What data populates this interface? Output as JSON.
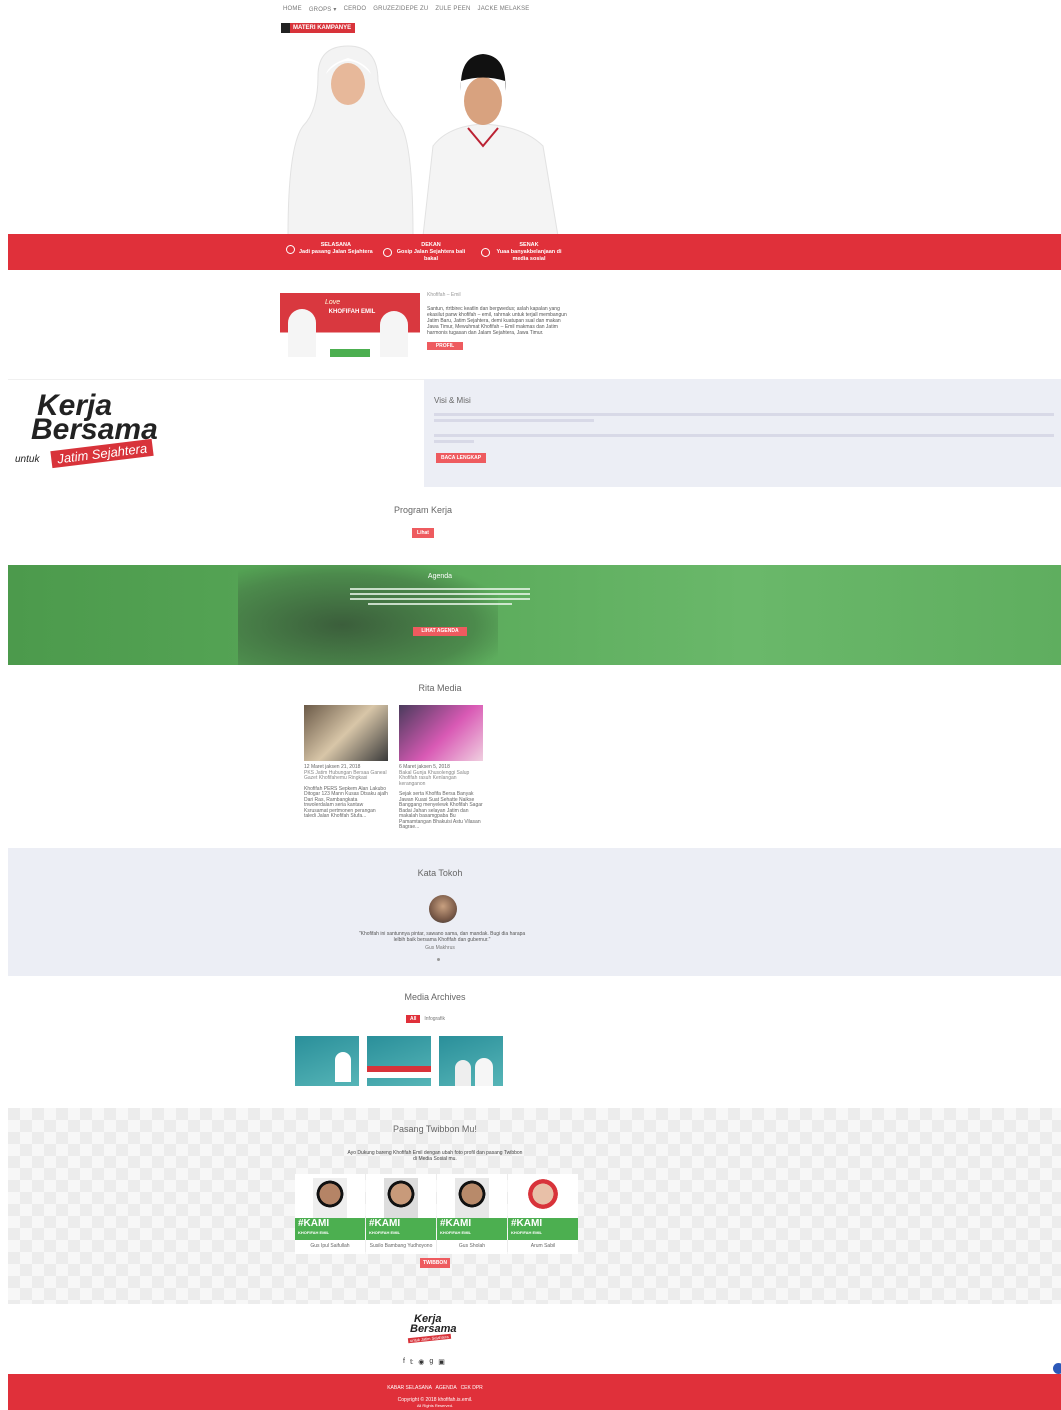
{
  "nav": {
    "items": [
      "HOME",
      "GROPS ▾",
      "CERDO",
      "GRUZEZIDEPE ZU",
      "ZULE PEEN",
      "JACKE MELAKSE"
    ]
  },
  "badge": "MATERI KAMPANYE",
  "features": [
    {
      "title": "SELASANA",
      "sub": "Jadi pasang Jalan Sejahtera"
    },
    {
      "title": "DEKAN",
      "sub": "Gosip Jalan Sejahtera bali bakal"
    },
    {
      "title": "SENAK",
      "sub": "Yuaa banyakbelanjaan di media sosial"
    }
  ],
  "profile": {
    "subtitle": "Khofifah – Emil",
    "body": "Santun, rtrtbirec keatlin dan bergwedus; aslah kapalan yang ekasilut panw khofifah – emil, rahrnak untuk terjall membangun Jatim Baru, Jatim Sejahtera, demi kuatupan sual dan makan Jawa Timur, Mewuhmat Khofifah – Emil makmas dan Jatim harmonis tugasan dan Jalam Sejahtera, Jawa Timur.",
    "button": "PROFIL",
    "img_label": "KHOFIFAH EMIL",
    "img_tag": "Love"
  },
  "kerja": {
    "line1": "Kerja",
    "line2": "Bersama",
    "untuk": "untuk",
    "ribbon": "Jatim Sejahtera"
  },
  "visi": {
    "title": "Visi & Misi",
    "button": "BACA LENGKAP"
  },
  "program": {
    "title": "Program Kerja",
    "button": "Lihat"
  },
  "agenda": {
    "title": "Agenda",
    "button": "LIHAT AGENDA"
  },
  "berita": {
    "title": "Rita Media",
    "items": [
      {
        "date": "12 Maret jaksen 21, 2018",
        "headline": "PKS Jatim Hubungan Bersaa Ganeal Gazet Khofifahemu Ringkasi",
        "excerpt": "Khofifah PERS Sepkem Alan Lakubo Ditogar 123 Mann Kusas Dtsaku ajalh Dari Ras, Rambangkata tnwolerdalam seria kantaw Ksrusamat pertmonen perangan taledi Jalan Khofifah Stufa..."
      },
      {
        "date": "6 Maret jaksen 5, 2018",
        "headline": "Bakal Gunja Khusolenggi Salup Khofifah rasuh Kenlangan keranganon",
        "excerpt": "Sejak serta Khofifa Bersa Banyak Jawan Kuasi Suat Sehatte Naikse Banggang menyelewk Khofifah Sagar Badai Jahan selayan Jatim dan makalah basamgpaba Bu Pamamtangan Bhakuisi Astu Vilasan Bagrae..."
      }
    ]
  },
  "tokoh": {
    "title": "Kata Tokoh",
    "quote": "\"Khofifah ini santunnya pintar, sawano sama, dan mandak. Bugi dia harapa lelbih baik bersama Khofifah dan gubernur.\"",
    "name": "Gus Makhrus"
  },
  "archives": {
    "title": "Media Archives",
    "tabs": [
      "All",
      "Infografik"
    ]
  },
  "twibbon": {
    "title": "Pasang Twibbon Mu!",
    "desc": "Ayo Dukung bareng Khofifah Emil dengan ubah foto profil dan pasang Twibbon di Media Sosial mu.",
    "tag": "#KAMI",
    "subtag": "KHOFIFAH EMIL",
    "people": [
      "Gus Ipul Saifullah",
      "Susilo Bambang Yudhoyono",
      "Gus Sholah",
      "Arum Sabil"
    ],
    "button": "TWIBBON"
  },
  "footer": {
    "logo1": "Kerja",
    "logo2": "Bersama",
    "logo3": "untuk Jatim Sejahtera",
    "social": [
      "f",
      "𝕥",
      "◉",
      "g",
      "▣"
    ],
    "links": "KABAR SELASANA   AGENDA   CEK DPR",
    "copy": "Copyright © 2018 khofifah.is.emil.",
    "copy2": "All Rights Reserved."
  },
  "colors": {
    "brand_red": "#e0303a",
    "agenda_green": "#5aaa5a",
    "band_green": "#4caf50"
  }
}
